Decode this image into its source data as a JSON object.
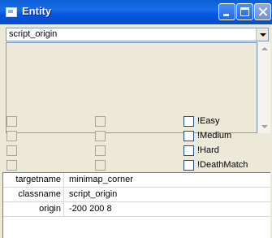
{
  "window": {
    "title": "Entity"
  },
  "class_select": {
    "value": "script_origin"
  },
  "spawnflags": {
    "col3": [
      "!Easy",
      "!Medium",
      "!Hard",
      "!DeathMatch"
    ]
  },
  "keyvalues": [
    {
      "key": "targetname",
      "value": "minimap_corner"
    },
    {
      "key": "classname",
      "value": "script_origin"
    },
    {
      "key": "origin",
      "value": "-200 200 8"
    }
  ]
}
